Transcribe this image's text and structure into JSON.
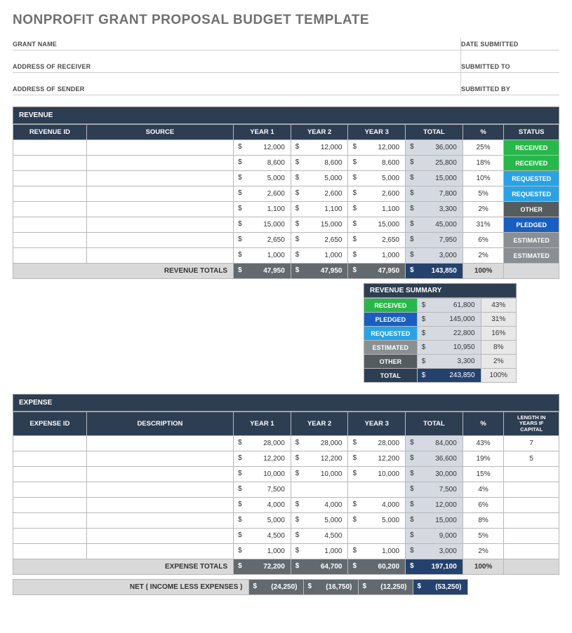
{
  "title": "NONPROFIT GRANT PROPOSAL BUDGET TEMPLATE",
  "meta": {
    "left": [
      "GRANT NAME",
      "ADDRESS OF RECEIVER",
      "ADDRESS OF SENDER"
    ],
    "right": [
      "DATE SUBMITTED",
      "SUBMITTED TO",
      "SUBMITTED BY"
    ]
  },
  "revenue": {
    "section": "REVENUE",
    "headers": [
      "REVENUE ID",
      "SOURCE",
      "YEAR 1",
      "YEAR 2",
      "YEAR 3",
      "TOTAL",
      "%",
      "STATUS"
    ],
    "rows": [
      {
        "y1": "12,000",
        "y2": "12,000",
        "y3": "12,000",
        "tot": "36,000",
        "pct": "25%",
        "status": "RECEIVED",
        "cls": "st-received"
      },
      {
        "y1": "8,600",
        "y2": "8,600",
        "y3": "8,600",
        "tot": "25,800",
        "pct": "18%",
        "status": "RECEIVED",
        "cls": "st-received"
      },
      {
        "y1": "5,000",
        "y2": "5,000",
        "y3": "5,000",
        "tot": "15,000",
        "pct": "10%",
        "status": "REQUESTED",
        "cls": "st-requested"
      },
      {
        "y1": "2,600",
        "y2": "2,600",
        "y3": "2,600",
        "tot": "7,800",
        "pct": "5%",
        "status": "REQUESTED",
        "cls": "st-requested"
      },
      {
        "y1": "1,100",
        "y2": "1,100",
        "y3": "1,100",
        "tot": "3,300",
        "pct": "2%",
        "status": "OTHER",
        "cls": "st-other"
      },
      {
        "y1": "15,000",
        "y2": "15,000",
        "y3": "15,000",
        "tot": "45,000",
        "pct": "31%",
        "status": "PLEDGED",
        "cls": "st-pledged"
      },
      {
        "y1": "2,650",
        "y2": "2,650",
        "y3": "2,650",
        "tot": "7,950",
        "pct": "6%",
        "status": "ESTIMATED",
        "cls": "st-estimated"
      },
      {
        "y1": "1,000",
        "y2": "1,000",
        "y3": "1,000",
        "tot": "3,000",
        "pct": "2%",
        "status": "ESTIMATED",
        "cls": "st-estimated"
      }
    ],
    "totals": {
      "label": "REVENUE TOTALS",
      "y1": "47,950",
      "y2": "47,950",
      "y3": "47,950",
      "tot": "143,850",
      "pct": "100%"
    }
  },
  "summary": {
    "title": "REVENUE SUMMARY",
    "rows": [
      {
        "label": "RECEIVED",
        "cls": "st-received",
        "amt": "61,800",
        "pct": "43%"
      },
      {
        "label": "PLEDGED",
        "cls": "st-pledged",
        "amt": "145,000",
        "pct": "31%"
      },
      {
        "label": "REQUESTED",
        "cls": "st-requested",
        "amt": "22,800",
        "pct": "16%"
      },
      {
        "label": "ESTIMATED",
        "cls": "st-estimated",
        "amt": "10,950",
        "pct": "8%"
      },
      {
        "label": "OTHER",
        "cls": "st-other",
        "amt": "3,300",
        "pct": "2%"
      }
    ],
    "total": {
      "label": "TOTAL",
      "amt": "243,850",
      "pct": "100%"
    }
  },
  "expense": {
    "section": "EXPENSE",
    "headers": [
      "EXPENSE ID",
      "DESCRIPTION",
      "YEAR 1",
      "YEAR 2",
      "YEAR 3",
      "TOTAL",
      "%",
      "LENGTH IN YEARS IF CAPITAL"
    ],
    "rows": [
      {
        "y1": "28,000",
        "y2": "28,000",
        "y3": "28,000",
        "tot": "84,000",
        "pct": "43%",
        "len": "7"
      },
      {
        "y1": "12,200",
        "y2": "12,200",
        "y3": "12,200",
        "tot": "36,600",
        "pct": "19%",
        "len": "5"
      },
      {
        "y1": "10,000",
        "y2": "10,000",
        "y3": "10,000",
        "tot": "30,000",
        "pct": "15%",
        "len": ""
      },
      {
        "y1": "7,500",
        "y2": "",
        "y3": "",
        "tot": "7,500",
        "pct": "4%",
        "len": ""
      },
      {
        "y1": "4,000",
        "y2": "4,000",
        "y3": "4,000",
        "tot": "12,000",
        "pct": "6%",
        "len": ""
      },
      {
        "y1": "5,000",
        "y2": "5,000",
        "y3": "5,000",
        "tot": "15,000",
        "pct": "8%",
        "len": ""
      },
      {
        "y1": "4,500",
        "y2": "4,500",
        "y3": "",
        "tot": "9,000",
        "pct": "5%",
        "len": ""
      },
      {
        "y1": "1,000",
        "y2": "1,000",
        "y3": "1,000",
        "tot": "3,000",
        "pct": "2%",
        "len": ""
      }
    ],
    "totals": {
      "label": "EXPENSE TOTALS",
      "y1": "72,200",
      "y2": "64,700",
      "y3": "60,200",
      "tot": "197,100",
      "pct": "100%"
    }
  },
  "net": {
    "label": "NET ( INCOME LESS EXPENSES )",
    "y1": "(24,250)",
    "y2": "(16,750)",
    "y3": "(12,250)",
    "tot": "(53,250)"
  },
  "sym": "$"
}
